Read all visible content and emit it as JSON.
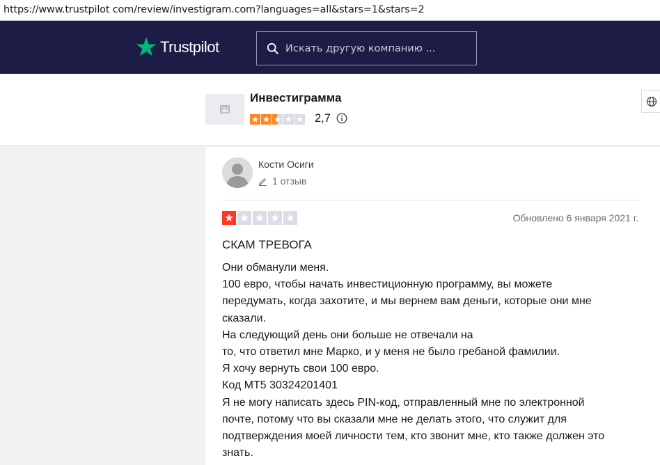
{
  "browser": {
    "url": "https://www.trustpilot com/review/investigram.com?languages=all&stars=1&stars=2"
  },
  "header": {
    "logo_text": "Trustpilot",
    "search_placeholder": "Искать другую компанию ...",
    "brand_color": "#00b67a",
    "nav_bg": "#1c1c46"
  },
  "company": {
    "name": "Инвестиграмма",
    "rating": "2,7",
    "stars_filled": 2.5,
    "star_color": "#ff8622"
  },
  "review": {
    "author": "Кости Осиги",
    "review_count": "1 отзыв",
    "stars": 1,
    "star_color": "#ff3722",
    "date": "Обновлено 6 января 2021 г.",
    "title": "СКАМ ТРЕВОГА",
    "body_lines": [
      "Они обманули меня.",
      "100 евро, чтобы начать инвестиционную программу, вы можете",
      "передумать, когда захотите, и мы вернем вам деньги, которые они мне",
      "сказали.",
      "На следующий день они больше не отвечали на",
      "то, что ответил мне Марко, и у меня не было гребаной фамилии.",
      "Я хочу вернуть свои 100 евро.",
      "Код МТ5 30324201401",
      "Я не могу написать здесь PIN-код, отправленный мне по электронной",
      "почте, потому что вы сказали мне не делать этого, что служит для",
      "подтверждения моей личности тем, кто звонит мне, кто также должен это",
      "знать."
    ]
  }
}
